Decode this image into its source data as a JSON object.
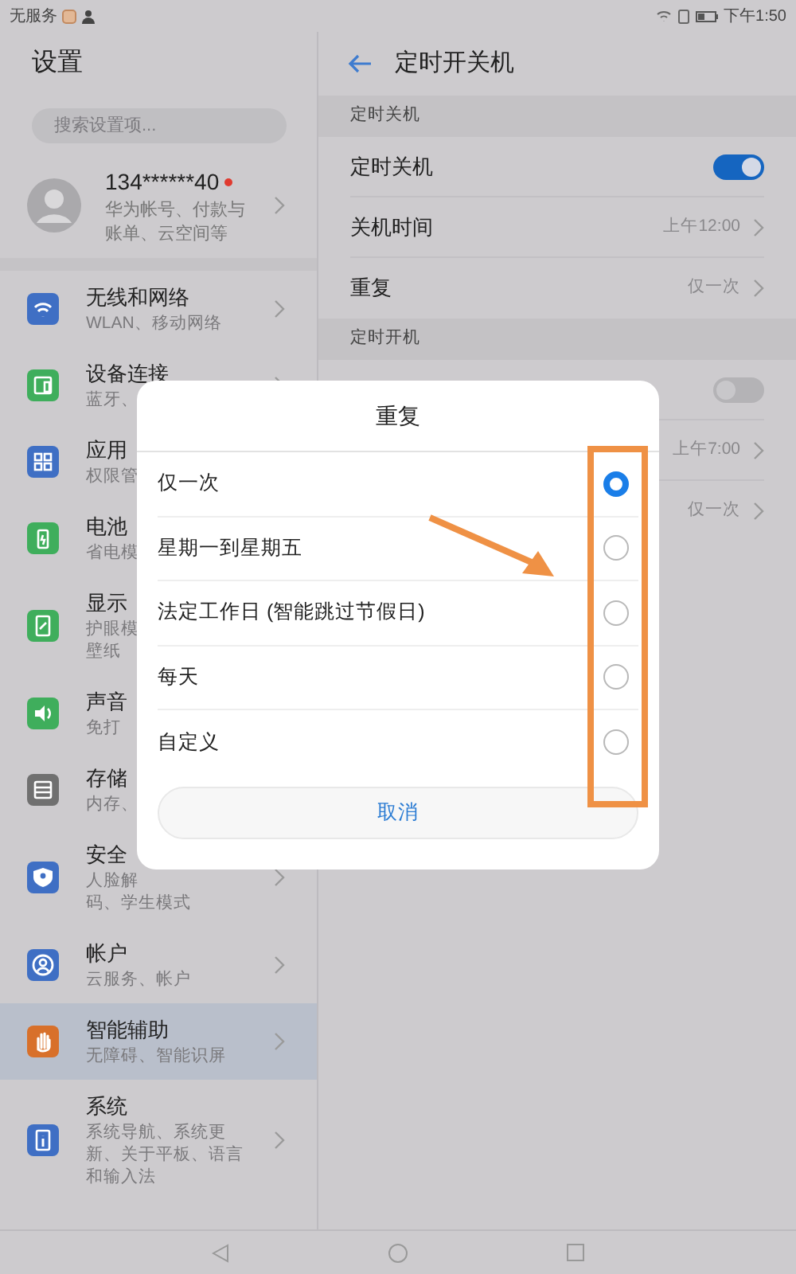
{
  "status_bar": {
    "carrier": "无服务",
    "time": "下午1:50"
  },
  "sidebar": {
    "title": "设置",
    "search": {
      "placeholder": "搜索设置项..."
    },
    "account": {
      "name": "134******40",
      "subtitle": [
        "华为帐号、付款与",
        "账单、云空间等"
      ],
      "notification": true
    },
    "items": [
      {
        "title": "无线和网络",
        "subtitle": [
          "WLAN、移动网络"
        ],
        "color": "#3f6fc4",
        "selected": false
      },
      {
        "title": "设备连接",
        "subtitle": [
          "蓝牙、"
        ],
        "color": "#3fae5c",
        "selected": false
      },
      {
        "title": "应用",
        "subtitle": [
          "权限管"
        ],
        "color": "#3f6fc4",
        "selected": false,
        "chevron": false
      },
      {
        "title": "电池",
        "subtitle": [
          "省电模"
        ],
        "color": "#3fae5c",
        "selected": false,
        "chevron": false
      },
      {
        "title": "显示",
        "subtitle": [
          "护眼模",
          "壁纸"
        ],
        "color": "#3fae5c",
        "selected": false,
        "chevron": false
      },
      {
        "title": "声音",
        "subtitle": [
          "免打"
        ],
        "color": "#3fae5c",
        "selected": false,
        "chevron": false
      },
      {
        "title": "存储",
        "subtitle": [
          "内存、"
        ],
        "color": "#707070",
        "selected": false
      },
      {
        "title": "安全",
        "subtitle": [
          "人脸解",
          "码、学生模式"
        ],
        "color": "#3f6fc4",
        "selected": false
      },
      {
        "title": "帐户",
        "subtitle": [
          "云服务、帐户"
        ],
        "color": "#3f6fc4",
        "selected": false
      },
      {
        "title": "智能辅助",
        "subtitle": [
          "无障碍、智能识屏"
        ],
        "color": "#d8702a",
        "selected": true
      },
      {
        "title": "系统",
        "subtitle": [
          "系统导航、系统更",
          "新、关于平板、语言",
          "和输入法"
        ],
        "color": "#3f6fc4",
        "selected": false
      }
    ]
  },
  "detail": {
    "title": "定时开关机",
    "sections": [
      {
        "label": "定时关机",
        "rows": [
          {
            "kind": "toggle",
            "label": "定时关机",
            "on": true
          },
          {
            "kind": "value",
            "label": "关机时间",
            "value": "上午12:00"
          },
          {
            "kind": "value",
            "label": "重复",
            "value": "仅一次"
          }
        ]
      },
      {
        "label": "定时开机",
        "rows": [
          {
            "kind": "toggle",
            "on": false
          },
          {
            "kind": "value",
            "value": "上午7:00"
          },
          {
            "kind": "value",
            "value": "仅一次"
          }
        ]
      }
    ]
  },
  "dialog": {
    "title": "重复",
    "options": [
      {
        "label": "仅一次",
        "selected": true
      },
      {
        "label": "星期一到星期五",
        "selected": false
      },
      {
        "label": "法定工作日 (智能跳过节假日)",
        "selected": false
      },
      {
        "label": "每天",
        "selected": false
      },
      {
        "label": "自定义",
        "selected": false
      }
    ],
    "cancel": "取消"
  }
}
